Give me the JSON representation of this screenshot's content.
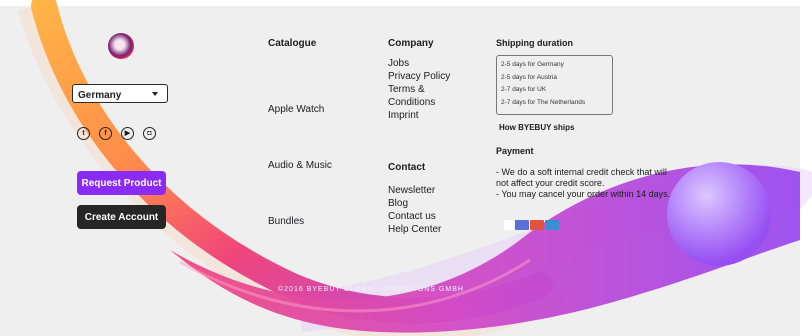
{
  "brand": {
    "logo_icon": "byebuy-orb-logo-icon"
  },
  "country_select": {
    "selected": "Germany"
  },
  "socials": [
    {
      "icon": "twitter-icon",
      "glyph": "t"
    },
    {
      "icon": "facebook-icon",
      "glyph": "f"
    },
    {
      "icon": "youtube-icon",
      "glyph": "▶"
    },
    {
      "icon": "instagram-icon",
      "glyph": "◘"
    }
  ],
  "buttons": {
    "request_product": "Request Product",
    "create_account": "Create Account"
  },
  "catalogue": {
    "heading": "Catalogue",
    "items": [
      "Apple Watch",
      "Audio & Music",
      "Bundles"
    ]
  },
  "company": {
    "heading": "Company",
    "items": [
      "Jobs",
      "Privacy Policy",
      "Terms &",
      "Conditions",
      "Imprint"
    ]
  },
  "contact": {
    "heading": "Contact",
    "items": [
      "Newsletter",
      "Blog",
      "Contact us",
      "Help Center"
    ]
  },
  "shipping": {
    "heading": "Shipping duration",
    "options": [
      "2-5 days for Germany",
      "2-5 days for Austria",
      "2-7 days for UK",
      "2-7 days for The Netherlands"
    ],
    "how_link": "How BYEBUY ships"
  },
  "payment": {
    "heading": "Payment",
    "lines": [
      "- We do a soft internal credit check that will not affect your credit score.",
      "- You may cancel your order within 14 days."
    ]
  },
  "footer": {
    "copyright": "©2016 BYEBUY GLOBAL OPERATIONS GMBH"
  },
  "colors": {
    "purple": "#8a2bf5",
    "dark": "#262626",
    "pink": "#ee3a7a",
    "orange": "#ffae3b",
    "bg": "#efefef"
  }
}
